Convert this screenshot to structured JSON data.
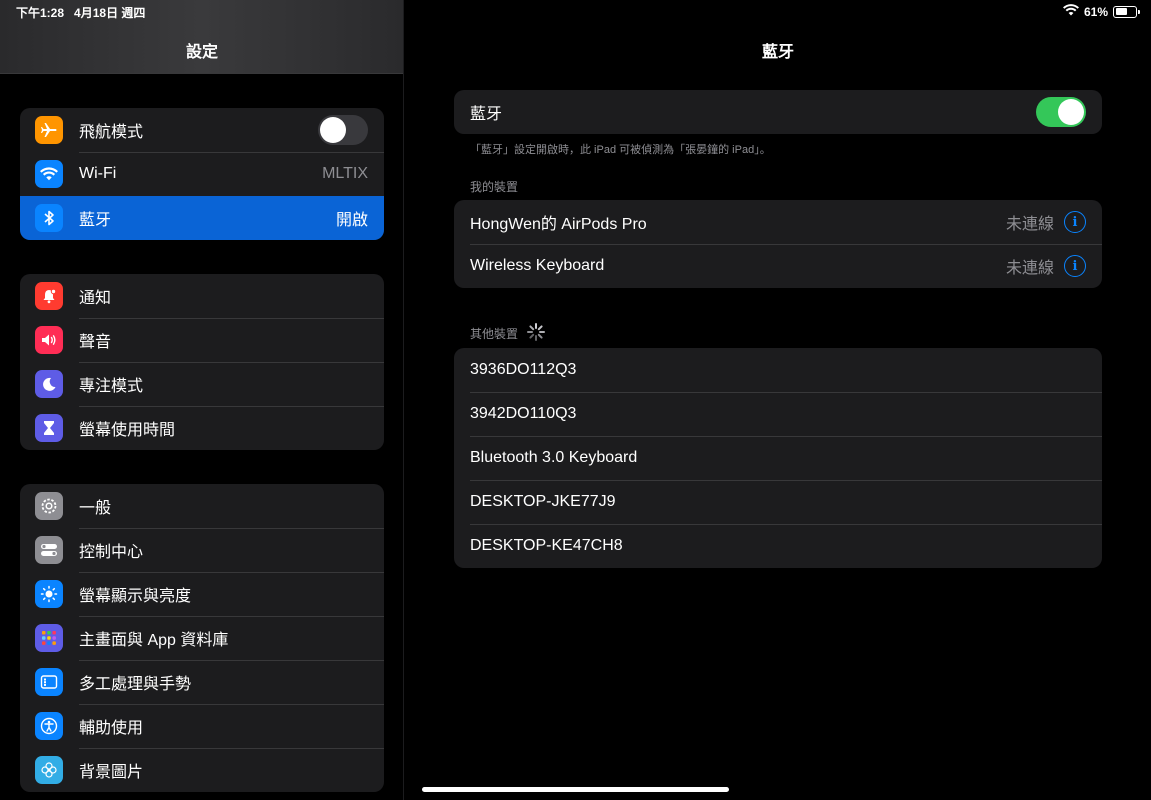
{
  "status": {
    "time": "下午1:28",
    "date": "4月18日 週四",
    "battery": "61%",
    "battery_level": 0.61
  },
  "sidebar": {
    "title": "設定",
    "group1": [
      {
        "label": "飛航模式",
        "icon": "airplane-icon",
        "color": "#ff9500",
        "toggle": "off"
      },
      {
        "label": "Wi-Fi",
        "icon": "wifi-icon",
        "color": "#0a84ff",
        "value": "MLTIX"
      },
      {
        "label": "藍牙",
        "icon": "bluetooth-icon",
        "color": "#0a84ff",
        "value": "開啟",
        "selected": true
      }
    ],
    "group2": [
      {
        "label": "通知",
        "icon": "bell-icon",
        "color": "#ff3b30"
      },
      {
        "label": "聲音",
        "icon": "speaker-icon",
        "color": "#ff2d55"
      },
      {
        "label": "專注模式",
        "icon": "moon-icon",
        "color": "#5e5ce6"
      },
      {
        "label": "螢幕使用時間",
        "icon": "hourglass-icon",
        "color": "#5e5ce6"
      }
    ],
    "group3": [
      {
        "label": "一般",
        "icon": "gear-icon",
        "color": "#8e8e93"
      },
      {
        "label": "控制中心",
        "icon": "switches-icon",
        "color": "#8e8e93"
      },
      {
        "label": "螢幕顯示與亮度",
        "icon": "sun-icon",
        "color": "#0a84ff"
      },
      {
        "label": "主畫面與 App 資料庫",
        "icon": "grid-icon",
        "color": "#5e5ce6"
      },
      {
        "label": "多工處理與手勢",
        "icon": "multitask-icon",
        "color": "#0a84ff"
      },
      {
        "label": "輔助使用",
        "icon": "accessibility-icon",
        "color": "#0a84ff"
      },
      {
        "label": "背景圖片",
        "icon": "flower-icon",
        "color": "#32ade6"
      }
    ]
  },
  "main": {
    "title": "藍牙",
    "bluetooth_label": "藍牙",
    "bluetooth_toggle": "on",
    "footnote": "「藍牙」設定開啟時，此 iPad 可被偵測為「張晏鐘的 iPad」。",
    "my_devices_header": "我的裝置",
    "my_devices": [
      {
        "name": "HongWen的 AirPods Pro",
        "status": "未連線"
      },
      {
        "name": "Wireless Keyboard",
        "status": "未連線"
      }
    ],
    "other_devices_header": "其他裝置",
    "other_devices": [
      "3936DO112Q3",
      "3942DO110Q3",
      "Bluetooth 3.0 Keyboard",
      "DESKTOP-JKE77J9",
      "DESKTOP-KE47CH8"
    ]
  },
  "colors": {
    "accent": "#0a84ff",
    "toggle_on": "#34c759",
    "selected_row": "#0a64d6"
  }
}
